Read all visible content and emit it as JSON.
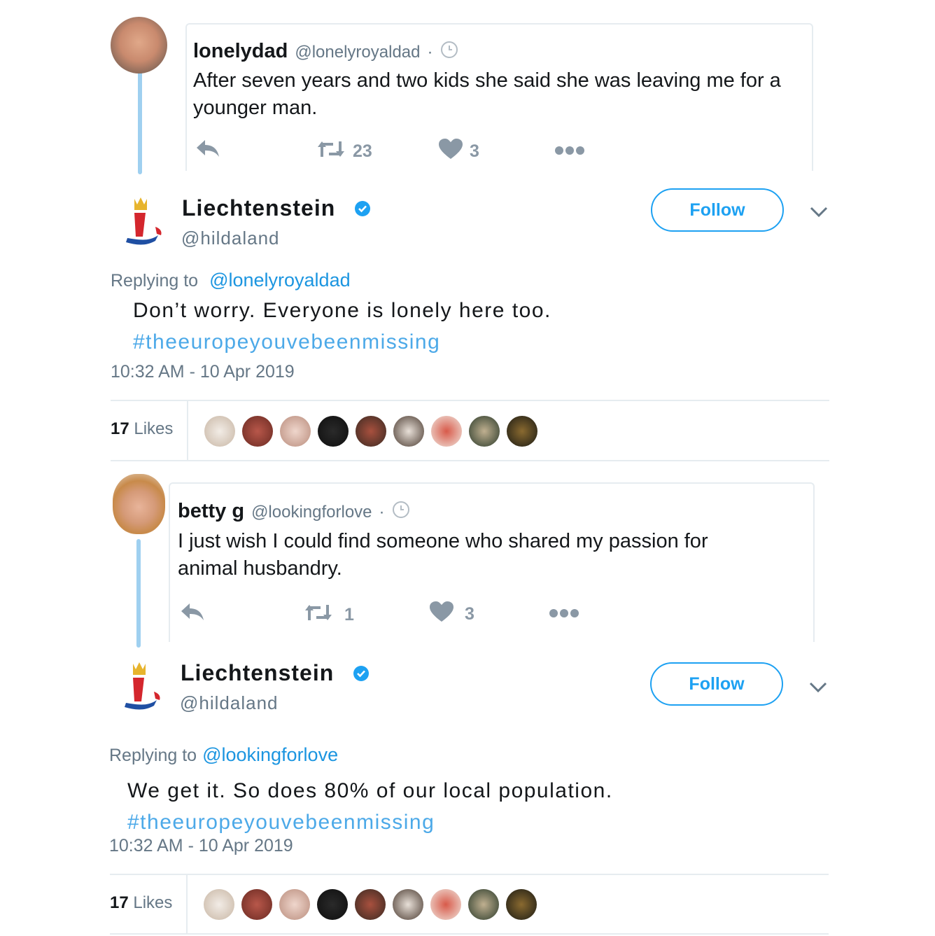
{
  "tweets": [
    {
      "quoted": {
        "name": "lonelydad",
        "handle": "@lonelyroyaldad",
        "dot": "·",
        "text": "After seven years and two kids she said she was leaving me for a younger man.",
        "retweets": "23",
        "likes": "3"
      },
      "reply": {
        "name": "Liechtenstein",
        "handle": "@hildaland",
        "follow_label": "Follow",
        "replying_label": "Replying to",
        "replying_to": "@lonelyroyaldad",
        "text": "Don’t worry. Everyone is lonely here too.",
        "hashtag": "#theeuropeyouvebeenmissing",
        "time": "10:32 AM - 10 Apr 2019",
        "likes_count": "17",
        "likes_label": "Likes"
      }
    },
    {
      "quoted": {
        "name": "betty g",
        "handle": "@lookingforlove",
        "dot": "·",
        "text": "I just wish I could find someone who shared my passion for animal husbandry.",
        "retweets": "1",
        "likes": "3"
      },
      "reply": {
        "name": "Liechtenstein",
        "handle": "@hildaland",
        "follow_label": "Follow",
        "replying_label": "Replying to",
        "replying_to": "@lookingforlove",
        "text": "We get it. So does 80% of our local population.",
        "hashtag": "#theeuropeyouvebeenmissing",
        "time": "10:32 AM - 10 Apr 2019",
        "likes_count": "17",
        "likes_label": "Likes"
      }
    }
  ],
  "colors": {
    "accent": "#1da1f2",
    "hashtag": "#4ca9e8",
    "thread_line": "#9fd0f0",
    "muted": "#657786"
  },
  "likers": [
    "#d9cfc4",
    "#7a3a30",
    "#c9a091",
    "#151515",
    "#5b3a30",
    "#8a7a6a",
    "#b04a40",
    "#3a4a3a",
    "#4a3a20"
  ]
}
